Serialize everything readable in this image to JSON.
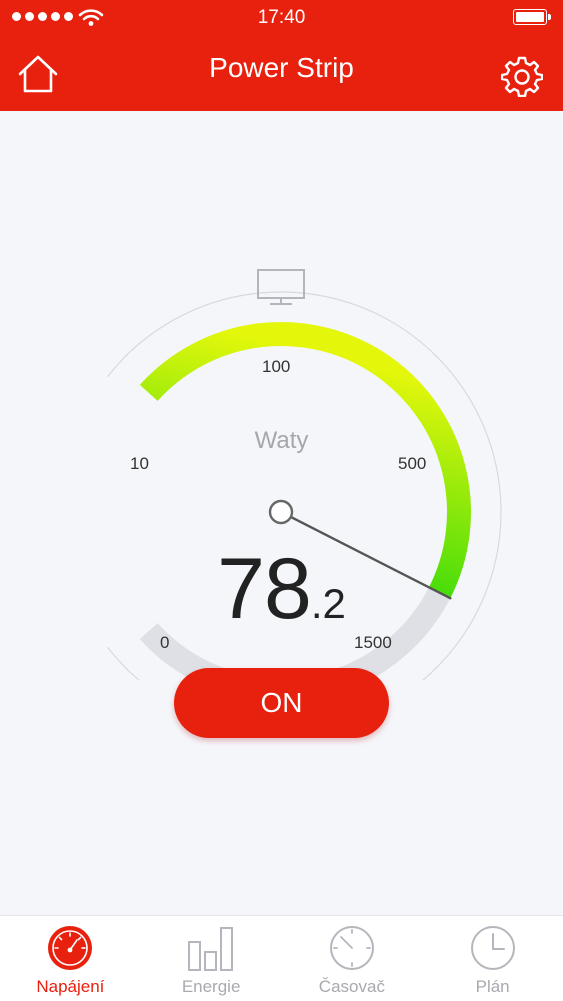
{
  "status_bar": {
    "time": "17:40"
  },
  "header": {
    "title": "Power Strip"
  },
  "gauge": {
    "unit": "Waty",
    "device_icon": "monitor-icon",
    "min_label": "0",
    "tick_labels": [
      "10",
      "100",
      "500"
    ],
    "max_label": "1500",
    "scale_max": 1500,
    "value": 78.2,
    "value_integer": "78",
    "value_decimal": ".2",
    "colors": {
      "low": "#14d40a",
      "high": "#e4f70b",
      "track": "#dfe0e6",
      "needle": "#555555"
    }
  },
  "power_button": {
    "label": "ON",
    "color": "#e8200e"
  },
  "tabs": [
    {
      "label": "Napájení",
      "icon": "speedometer-icon",
      "active": true
    },
    {
      "label": "Energie",
      "icon": "bar-chart-icon",
      "active": false
    },
    {
      "label": "Časovač",
      "icon": "timer-icon",
      "active": false
    },
    {
      "label": "Plán",
      "icon": "clock-icon",
      "active": false
    }
  ],
  "accent_color": "#e8200e"
}
